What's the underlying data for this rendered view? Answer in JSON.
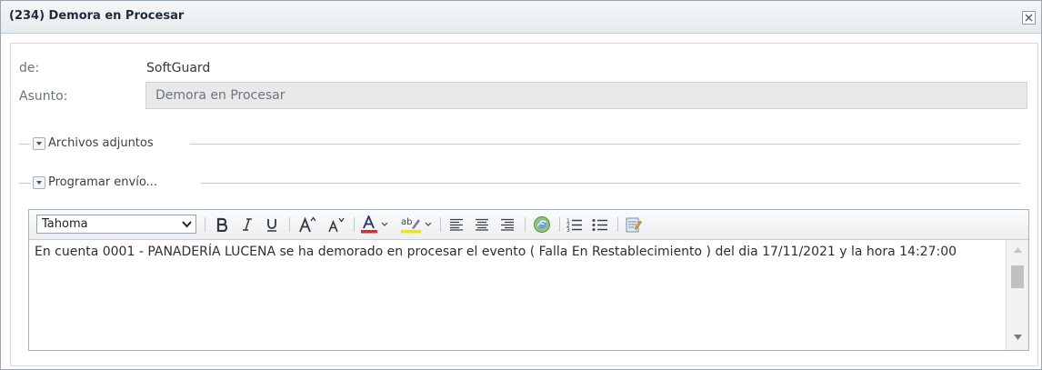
{
  "dialog": {
    "title": "(234) Demora en Procesar"
  },
  "form": {
    "from_label": "de:",
    "from_value": "SoftGuard",
    "subject_label": "Asunto:",
    "subject_value": "Demora en Procesar"
  },
  "sections": {
    "attachments": "Archivos adjuntos",
    "schedule": "Programar envío..."
  },
  "toolbar": {
    "font_family": "Tahoma",
    "icons": [
      "bold",
      "italic",
      "underline",
      "increase-font-size",
      "decrease-font-size",
      "font-color",
      "highlight-color",
      "align-left",
      "align-center",
      "align-right",
      "insert-link",
      "numbered-list",
      "bulleted-list",
      "source-edit"
    ],
    "font_color": "#d62d2d",
    "highlight_color": "#f3e600"
  },
  "editor": {
    "body": "En cuenta 0001 - PANADERÍA LUCENA se ha demorado en procesar el evento ( Falla En Restablecimiento ) del dia 17/11/2021 y la hora 14:27:00"
  }
}
